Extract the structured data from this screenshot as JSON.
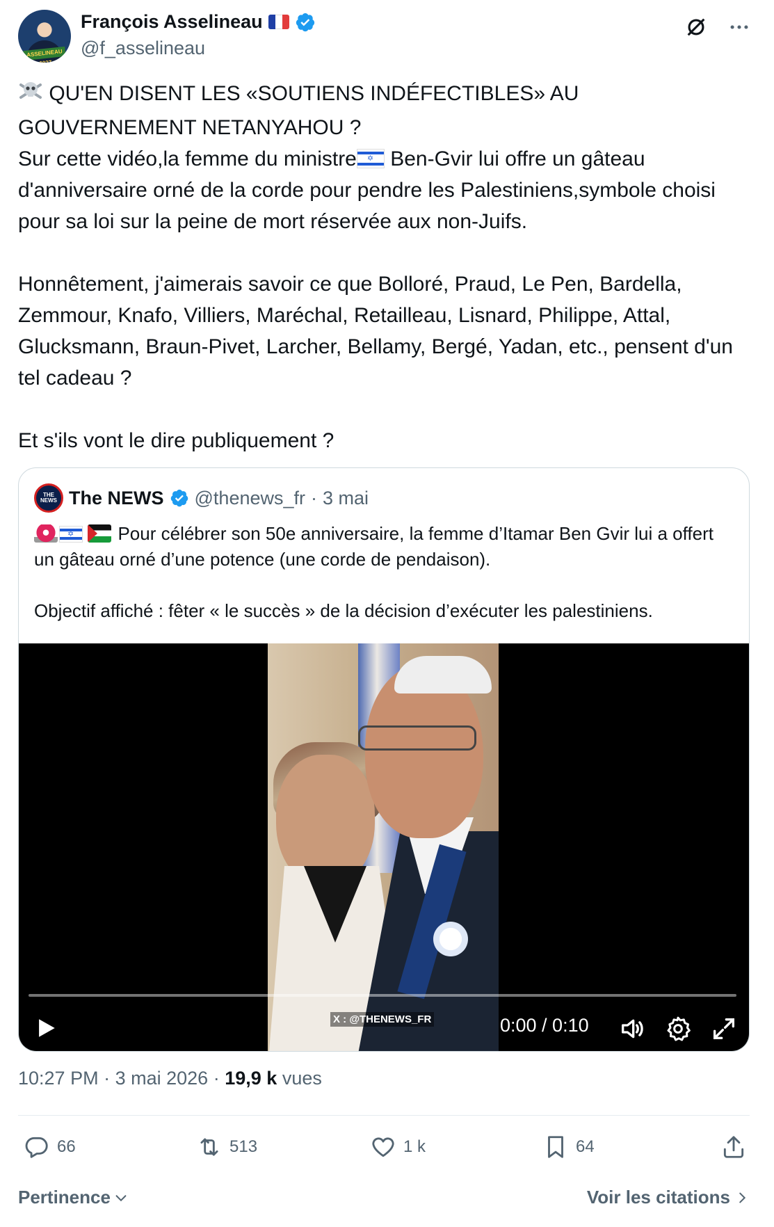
{
  "author": {
    "name": "François Asselineau",
    "handle": "@f_asselineau",
    "avatar_badge": "ASSELINEAU 2027",
    "flag_emoji": "french-flag"
  },
  "tweet": {
    "line1": "QU'EN DISENT LES «SOUTIENS INDÉFECTIBLES» AU GOUVERNEMENT NETANYAHOU ?",
    "line2a": "Sur cette vidéo,la femme du ministre",
    "line2b": "Ben-Gvir lui offre un gâteau d'anniversaire orné de la corde pour pendre les Palestiniens,symbole choisi pour sa loi sur la peine de mort réservée aux non-Juifs.",
    "paragraph2": "Honnêtement, j'aimerais savoir ce que Bolloré, Praud, Le Pen, Bardella, Zemmour, Knafo, Villiers, Maréchal, Retailleau, Lisnard, Philippe, Attal, Glucksmann, Braun-Pivet, Larcher, Bellamy, Bergé, Yadan, etc., pensent d'un tel cadeau ?",
    "paragraph3": "Et s'ils vont le dire publiquement ?"
  },
  "quote": {
    "name": "The NEWS",
    "handle": "@thenews_fr",
    "separator": "·",
    "date": "3 mai",
    "avatar_text": "THE NEWS",
    "text1": "Pour célébrer son 50e anniversaire, la femme d’Itamar Ben Gvir lui a offert un gâteau orné d’une potence (une corde de pendaison).",
    "text2": "Objectif affiché : fêter « le succès » de la décision d’exécuter les palestiniens.",
    "video": {
      "watermark": "X : @THENEWS_FR",
      "time": "0:00 / 0:10",
      "progress": 0
    }
  },
  "meta": {
    "time": "10:27 PM",
    "sep1": "·",
    "date": "3 mai 2026",
    "sep2": "·",
    "views_count": "19,9 k",
    "views_label": "vues"
  },
  "actions": {
    "replies": "66",
    "reposts": "513",
    "likes": "1 k",
    "bookmarks": "64"
  },
  "footer": {
    "sort_label": "Pertinence",
    "quotes_link": "Voir les citations"
  },
  "colors": {
    "verified": "#1d9bf0",
    "text_primary": "#0f1419",
    "text_secondary": "#536471",
    "border": "#cfd9de"
  }
}
